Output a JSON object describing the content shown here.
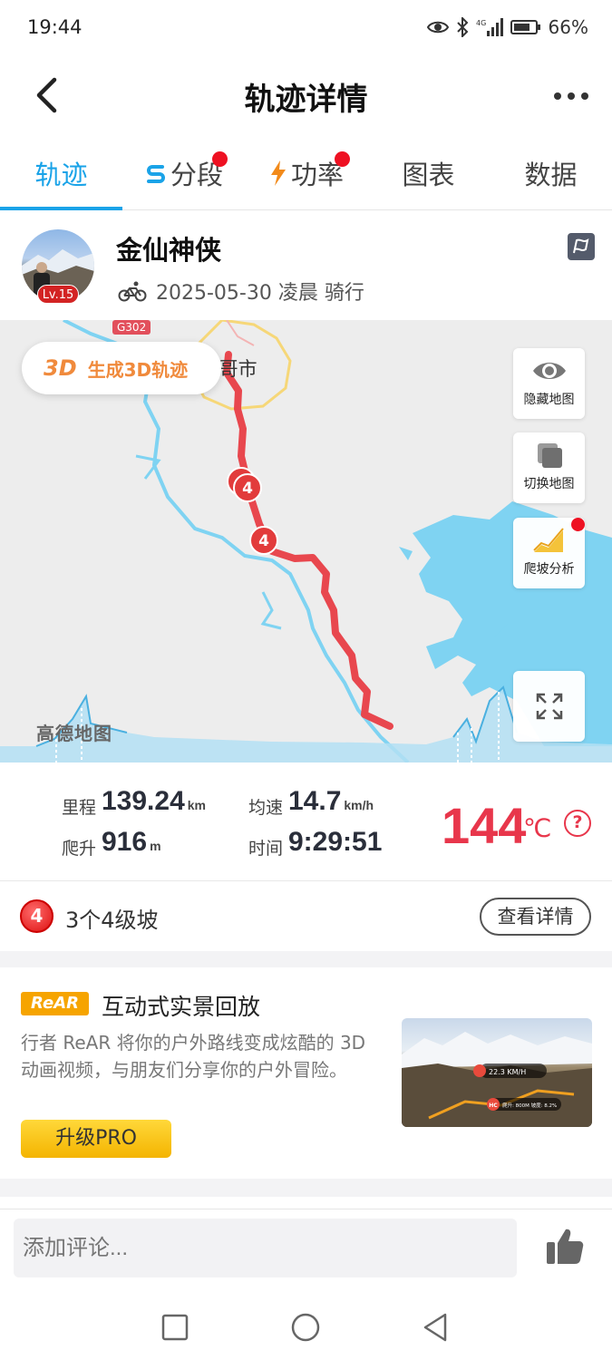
{
  "status_bar": {
    "time": "19:44",
    "battery": "66%"
  },
  "header": {
    "title": "轨迹详情"
  },
  "tabs": [
    {
      "label": "轨迹",
      "active": true
    },
    {
      "label": "分段",
      "dot": true
    },
    {
      "label": "功率",
      "dot": true
    },
    {
      "label": "图表"
    },
    {
      "label": "数据"
    }
  ],
  "profile": {
    "name": "金仙神侠",
    "level": "Lv.15",
    "meta": "2025-05-30 凌晨 骑行"
  },
  "map": {
    "btn_3d_icon": "3D",
    "btn_3d_label": "生成3D轨迹",
    "city_label": "军 哥市",
    "road_label": "G302",
    "watermark": "高德地图",
    "tools": {
      "hide_map": "隐藏地图",
      "switch_map": "切换地图",
      "climb_analysis": "爬坡分析"
    },
    "climb_marker": "4"
  },
  "stats": {
    "distance_label": "里程",
    "distance_value": "139.24",
    "distance_unit": "km",
    "climb_label": "爬升",
    "climb_value": "916",
    "climb_unit": "m",
    "speed_label": "均速",
    "speed_value": "14.7",
    "speed_unit": "km/h",
    "time_label": "时间",
    "time_value": "9:29:51",
    "temp_value": "144",
    "temp_unit": "℃",
    "help": "?"
  },
  "climbs": {
    "badge": "4",
    "text": "3个4级坡",
    "detail_button": "查看详情"
  },
  "rear": {
    "logo": "ReAR",
    "title": "互动式实景回放",
    "desc": "行者 ReAR 将你的户外路线变成炫酷的 3D 动画视频，与朋友们分享你的户外冒险。",
    "upgrade_button": "升级PRO",
    "thumb_speed": "22.3 KM/H",
    "thumb_stats": "爬升: 800M  坡度: 8.2%",
    "thumb_badge": "HC"
  },
  "comment": {
    "placeholder": "添加评论..."
  }
}
